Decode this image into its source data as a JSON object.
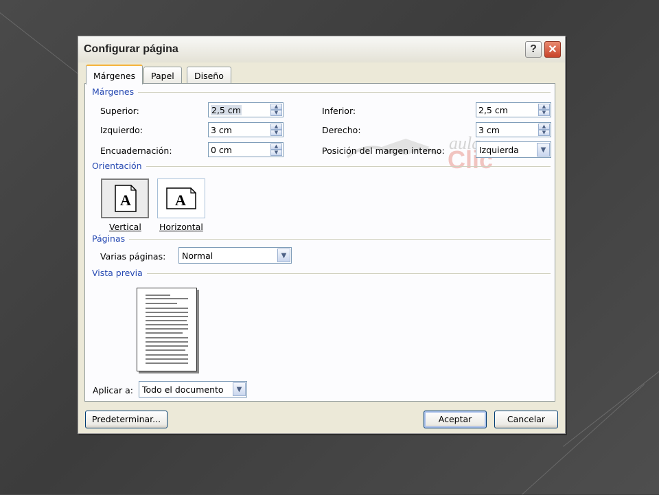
{
  "dialog": {
    "title": "Configurar página",
    "help_glyph": "?",
    "close_glyph": "✕"
  },
  "tabs": [
    {
      "label": "Márgenes",
      "active": true
    },
    {
      "label": "Papel",
      "active": false
    },
    {
      "label": "Diseño",
      "active": false
    }
  ],
  "margins": {
    "section": "Márgenes",
    "superior_label": "Superior:",
    "superior_value": "2,5 cm",
    "izquierdo_label": "Izquierdo:",
    "izquierdo_value": "3 cm",
    "encuadernacion_label": "Encuadernación:",
    "encuadernacion_value": "0 cm",
    "inferior_label": "Inferior:",
    "inferior_value": "2,5 cm",
    "derecho_label": "Derecho:",
    "derecho_value": "3 cm",
    "posicion_label": "Posición del margen interno:",
    "posicion_value": "Izquierda"
  },
  "orientation": {
    "section": "Orientación",
    "glyph": "A",
    "vertical_label": "Vertical",
    "horizontal_label": "Horizontal",
    "selected": "Vertical"
  },
  "pages": {
    "section": "Páginas",
    "varias_label": "Varias páginas:",
    "varias_value": "Normal"
  },
  "preview": {
    "section": "Vista previa"
  },
  "apply": {
    "label": "Aplicar a:",
    "value": "Todo el documento"
  },
  "buttons": {
    "default_label": "Predeterminar...",
    "ok_label": "Aceptar",
    "cancel_label": "Cancelar"
  },
  "watermark": {
    "top": "aula",
    "bottom": "Clic"
  },
  "icons": [
    "help-icon",
    "close-icon",
    "spin-up-icon",
    "spin-down-icon",
    "dropdown-arrow-icon",
    "page-portrait-icon",
    "page-landscape-icon"
  ],
  "colors": {
    "section_header": "#2649b2",
    "active_tab_accent": "#f5b33a",
    "dialog_bg": "#ece9d8"
  }
}
